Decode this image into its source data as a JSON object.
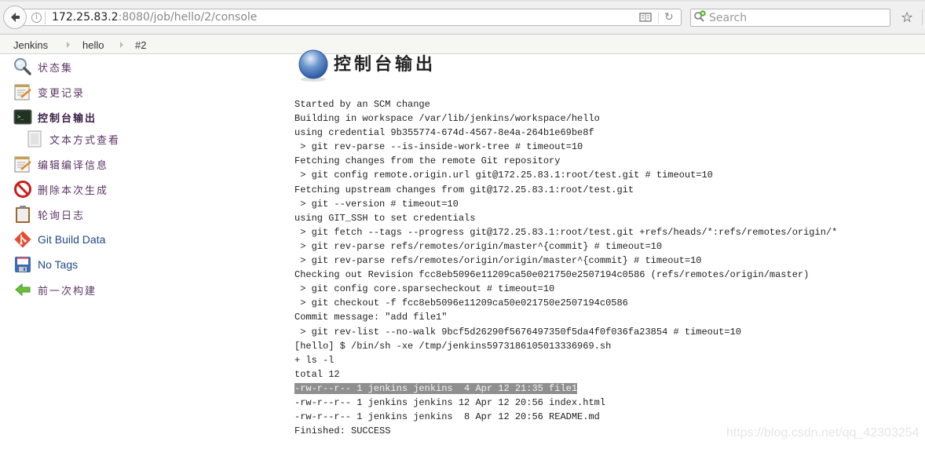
{
  "browser": {
    "url_host": "172.25.83.2",
    "url_rest": ":8080/job/hello/2/console",
    "search_placeholder": "Search"
  },
  "breadcrumb": [
    "Jenkins",
    "hello",
    "#2"
  ],
  "sidebar": {
    "items": [
      {
        "label": "状态集",
        "icon": "magnifier-icon"
      },
      {
        "label": "变更记录",
        "icon": "notepad-icon"
      },
      {
        "label": "控制台输出",
        "icon": "terminal-icon",
        "active": true
      },
      {
        "label": "文本方式查看",
        "icon": "document-icon",
        "sub": true
      },
      {
        "label": "编辑编译信息",
        "icon": "notepad-icon"
      },
      {
        "label": "删除本次生成",
        "icon": "no-entry-icon"
      },
      {
        "label": "轮询日志",
        "icon": "clipboard-icon"
      },
      {
        "label": "Git Build Data",
        "icon": "git-icon"
      },
      {
        "label": "No Tags",
        "icon": "floppy-disk-icon"
      },
      {
        "label": "前一次构建",
        "icon": "green-left-arrow-icon"
      }
    ]
  },
  "main": {
    "title": "控制台输出",
    "status_color": "#3465a4",
    "console_lines": [
      "Started by an SCM change",
      "Building in workspace /var/lib/jenkins/workspace/hello",
      "using credential 9b355774-674d-4567-8e4a-264b1e69be8f",
      " > git rev-parse --is-inside-work-tree # timeout=10",
      "Fetching changes from the remote Git repository",
      " > git config remote.origin.url git@172.25.83.1:root/test.git # timeout=10",
      "Fetching upstream changes from git@172.25.83.1:root/test.git",
      " > git --version # timeout=10",
      "using GIT_SSH to set credentials",
      " > git fetch --tags --progress git@172.25.83.1:root/test.git +refs/heads/*:refs/remotes/origin/*",
      " > git rev-parse refs/remotes/origin/master^{commit} # timeout=10",
      " > git rev-parse refs/remotes/origin/origin/master^{commit} # timeout=10",
      "Checking out Revision fcc8eb5096e11209ca50e021750e2507194c0586 (refs/remotes/origin/master)",
      " > git config core.sparsecheckout # timeout=10",
      " > git checkout -f fcc8eb5096e11209ca50e021750e2507194c0586",
      "Commit message: \"add file1\"",
      " > git rev-list --no-walk 9bcf5d26290f5676497350f5da4f0f036fa23854 # timeout=10",
      "[hello] $ /bin/sh -xe /tmp/jenkins5973186105013336969.sh",
      "+ ls -l",
      "total 12",
      "-rw-r--r-- 1 jenkins jenkins  4 Apr 12 21:35 file1",
      "-rw-r--r-- 1 jenkins jenkins 12 Apr 12 20:56 index.html",
      "-rw-r--r-- 1 jenkins jenkins  8 Apr 12 20:56 README.md",
      "Finished: SUCCESS"
    ],
    "highlighted_line_index": 20
  },
  "watermark": "https://blog.csdn.net/qq_42303254"
}
